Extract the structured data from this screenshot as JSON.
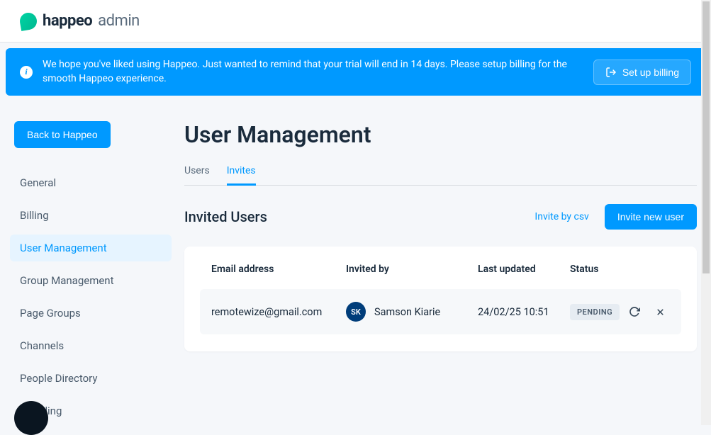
{
  "brand": {
    "name": "happeo",
    "suffix": "admin"
  },
  "banner": {
    "text": "We hope you've liked using Happeo. Just wanted to remind that your trial will end in 14 days. Please setup billing for the smooth Happeo experience.",
    "button": "Set up billing"
  },
  "sidebar": {
    "back": "Back to Happeo",
    "items": [
      {
        "label": "General",
        "active": false
      },
      {
        "label": "Billing",
        "active": false
      },
      {
        "label": "User Management",
        "active": true
      },
      {
        "label": "Group Management",
        "active": false
      },
      {
        "label": "Page Groups",
        "active": false
      },
      {
        "label": "Channels",
        "active": false
      },
      {
        "label": "People Directory",
        "active": false
      },
      {
        "label": "Branding",
        "active": false
      }
    ]
  },
  "page": {
    "title": "User Management",
    "tabs": [
      {
        "label": "Users",
        "active": false
      },
      {
        "label": "Invites",
        "active": true
      }
    ]
  },
  "section": {
    "title": "Invited Users",
    "csv_link": "Invite by csv",
    "invite_button": "Invite new user"
  },
  "table": {
    "headers": {
      "email": "Email address",
      "invited_by": "Invited by",
      "last_updated": "Last updated",
      "status": "Status"
    },
    "rows": [
      {
        "email": "remotewize@gmail.com",
        "inviter_initials": "SK",
        "inviter_name": "Samson Kiarie",
        "last_updated": "24/02/25 10:51",
        "status": "PENDING"
      }
    ]
  }
}
